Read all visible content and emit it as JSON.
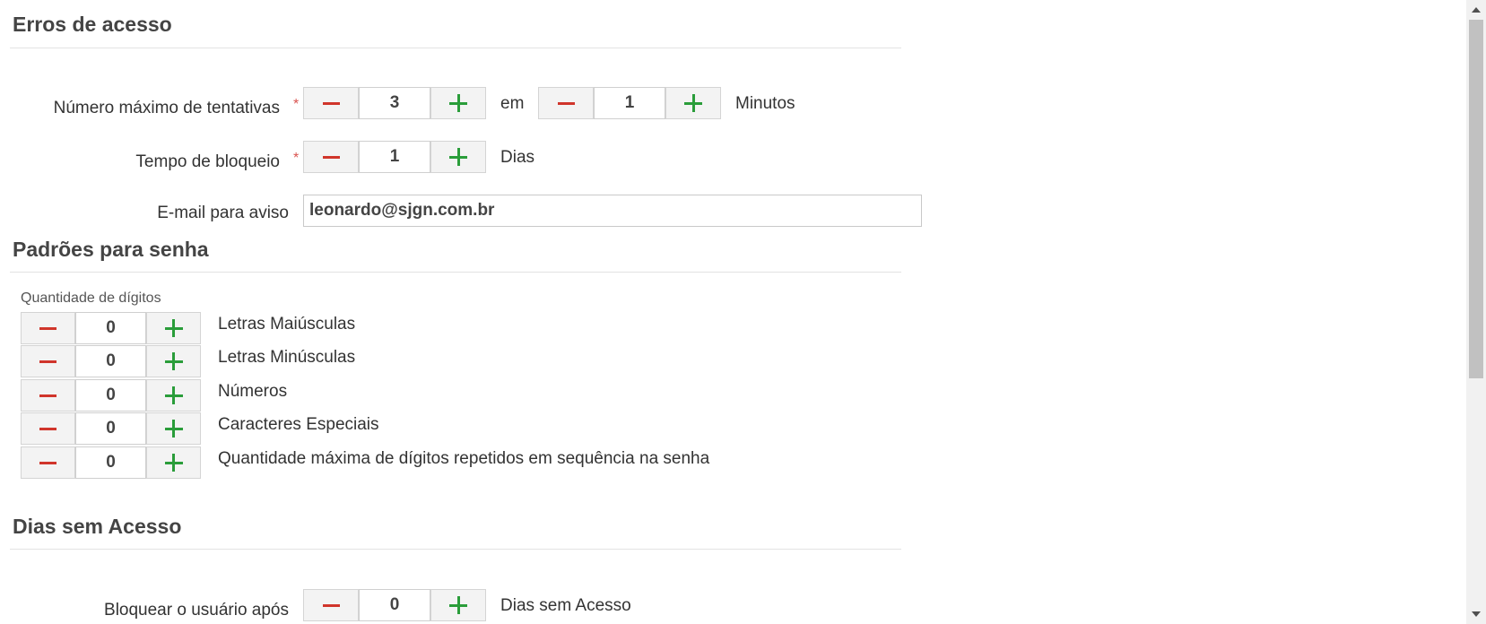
{
  "access_errors": {
    "title": "Erros de acesso",
    "max_attempts_label": "Número máximo de tentativas",
    "max_attempts_value": "3",
    "in_label": "em",
    "minutes_value": "1",
    "minutes_label": "Minutos",
    "block_time_label": "Tempo de bloqueio",
    "block_time_value": "1",
    "days_label": "Dias",
    "email_label": "E-mail para aviso",
    "email_value": "leonardo@sjgn.com.br",
    "required_mark": "*"
  },
  "password_patterns": {
    "title": "Padrões para senha",
    "digits_label": "Quantidade de dígitos",
    "rules": [
      {
        "value": "0",
        "label": "Letras Maiúsculas"
      },
      {
        "value": "0",
        "label": "Letras Minúsculas"
      },
      {
        "value": "0",
        "label": "Números"
      },
      {
        "value": "0",
        "label": "Caracteres Especiais"
      },
      {
        "value": "0",
        "label": "Quantidade máxima de dígitos repetidos em sequência na senha"
      }
    ]
  },
  "days_without_access": {
    "title": "Dias sem Acesso",
    "block_after_label": "Bloquear o usuário após",
    "block_after_value": "0",
    "suffix_label": "Dias sem Acesso"
  },
  "icons": {
    "minus": "minus-icon",
    "plus": "plus-icon"
  },
  "colors": {
    "minus": "#d0352b",
    "plus": "#2a9d3a",
    "required": "#d9534f"
  }
}
